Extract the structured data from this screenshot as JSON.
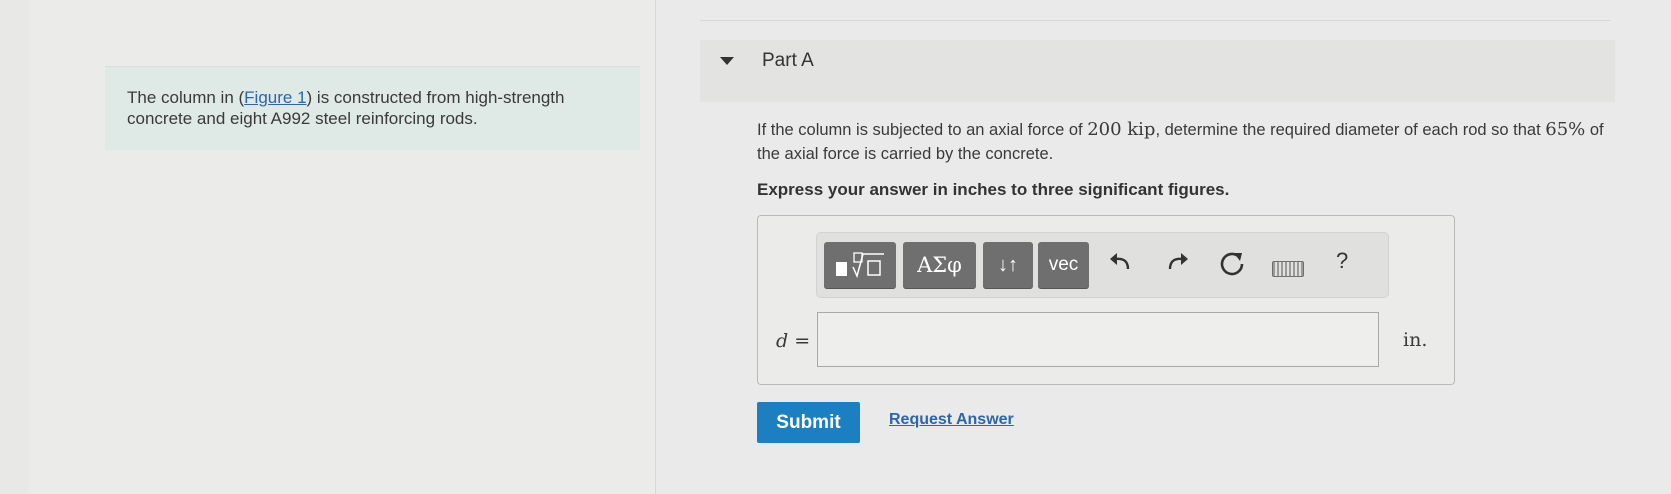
{
  "intro": {
    "text_before": "The column in (",
    "figure_link": "Figure 1",
    "text_after": ") is constructed from high-strength concrete and eight A992 steel reinforcing rods."
  },
  "part": {
    "title": "Part A"
  },
  "question": {
    "t1": "If the column is subjected to an axial force of ",
    "force": "200 kip",
    "t2": ", determine the required diameter of each rod so that ",
    "percent": "65%",
    "t3": " of the axial force is carried by the concrete."
  },
  "instruction": "Express your answer in inches to three significant figures.",
  "toolbar": {
    "buttons": [
      "ΑΣφ",
      "↓↑",
      "vec"
    ],
    "help": "?",
    "icons": [
      "templates-icon",
      "undo-icon",
      "redo-icon",
      "reset-icon",
      "keyboard-icon",
      "help-icon"
    ]
  },
  "answer": {
    "variable": "d",
    "equals": "=",
    "value": "",
    "unit": "in."
  },
  "actions": {
    "submit": "Submit",
    "request": "Request Answer"
  },
  "colors": {
    "submit_bg": "#1b7fc1",
    "link": "#2a66ad",
    "intro_bg": "#dfe9e5"
  }
}
